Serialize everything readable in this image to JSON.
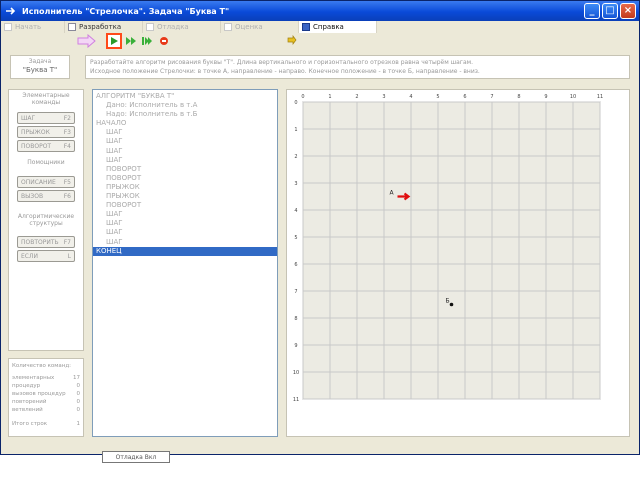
{
  "window": {
    "title": "Исполнитель \"Стрелочка\". Задача \"Буква Т\"",
    "controls": [
      "minimize",
      "maximize",
      "close"
    ]
  },
  "menu": {
    "items": [
      {
        "label": "Начать",
        "state": "disabled"
      },
      {
        "label": "Разработка",
        "state": "normal"
      },
      {
        "label": "Отладка",
        "state": "disabled"
      },
      {
        "label": "Оценка",
        "state": "disabled"
      },
      {
        "label": "Справка",
        "state": "active"
      }
    ]
  },
  "toolbar": {
    "buttons": [
      {
        "name": "arrow-pointer-icon"
      },
      {
        "name": "run-icon"
      },
      {
        "name": "step-icon"
      },
      {
        "name": "fast-forward-icon"
      },
      {
        "name": "stop-icon"
      },
      {
        "name": "help-icon"
      }
    ],
    "accent": "#ff4a1a"
  },
  "task": {
    "label": "Задача",
    "name": "\"Буква Т\"",
    "description_1": "Разработайте алгоритм рисования буквы \"Т\". Длина вертикального и горизонтального отрезков равна четырём шагам.",
    "description_2": "Исходное положение Стрелочки: в точке А, направление - направо. Конечное положение - в точке Б, направление - вниз."
  },
  "commands": {
    "basic_heading": "Элементарные команды",
    "basic": [
      {
        "label": "ШАГ",
        "key": "F2"
      },
      {
        "label": "ПРЫЖОК",
        "key": "F3"
      },
      {
        "label": "ПОВОРОТ",
        "key": "F4"
      }
    ],
    "helpers_heading": "Помощники",
    "helpers": [
      {
        "label": "ОПИСАНИЕ",
        "key": "F5"
      },
      {
        "label": "ВЫЗОВ",
        "key": "F6"
      }
    ],
    "structures_heading": "Алгоритмические структуры",
    "structures": [
      {
        "label": "ПОВТОРИТЬ",
        "key": "F7"
      },
      {
        "label": "ЕСЛИ",
        "key": "L"
      }
    ]
  },
  "stats": {
    "heading": "Количество команд:",
    "rows": [
      {
        "label": "элементарных",
        "value": "17"
      },
      {
        "label": "процедур",
        "value": "0"
      },
      {
        "label": "вызовов процедур",
        "value": "0"
      },
      {
        "label": "повторений",
        "value": "0"
      },
      {
        "label": "ветвлений",
        "value": "0"
      }
    ],
    "total_label": "Итого строк",
    "total_value": "1"
  },
  "program": {
    "lines": [
      {
        "text": "АЛГОРИТМ \"БУКВА Т\"",
        "indent": 0
      },
      {
        "text": "Дано: Исполнитель в т.А",
        "indent": 1
      },
      {
        "text": "Надо: Исполнитель в т.Б",
        "indent": 1
      },
      {
        "text": "НАЧАЛО",
        "indent": 0
      },
      {
        "text": "ШАГ",
        "indent": 1
      },
      {
        "text": "ШАГ",
        "indent": 1
      },
      {
        "text": "ШАГ",
        "indent": 1
      },
      {
        "text": "ШАГ",
        "indent": 1
      },
      {
        "text": "ПОВОРОТ",
        "indent": 1
      },
      {
        "text": "ПОВОРОТ",
        "indent": 1
      },
      {
        "text": "ПРЫЖОК",
        "indent": 1
      },
      {
        "text": "ПРЫЖОК",
        "indent": 1
      },
      {
        "text": "ПОВОРОТ",
        "indent": 1
      },
      {
        "text": "ШАГ",
        "indent": 1
      },
      {
        "text": "ШАГ",
        "indent": 1
      },
      {
        "text": "ШАГ",
        "indent": 1
      },
      {
        "text": "ШАГ",
        "indent": 1
      },
      {
        "text": "КОНЕЦ",
        "indent": 0,
        "selected": true
      }
    ],
    "selection_color": "#316ac5"
  },
  "field": {
    "columns": [
      "0",
      "1",
      "2",
      "3",
      "4",
      "5",
      "6",
      "7",
      "8",
      "9",
      "10",
      "11"
    ],
    "rows": [
      "0",
      "1",
      "2",
      "3",
      "4",
      "5",
      "6",
      "7",
      "8",
      "9",
      "10",
      "11"
    ],
    "grid_color": "#c8c8c8",
    "background": "#ecebe3",
    "point_a": {
      "label": "А",
      "col": 3.5,
      "row": 3.5
    },
    "point_b": {
      "label": "Б",
      "col": 5.5,
      "row": 7.5
    },
    "arrow": {
      "direction": "right",
      "color": "#e01010"
    }
  },
  "status": {
    "text": "Отладка  Вкл"
  }
}
